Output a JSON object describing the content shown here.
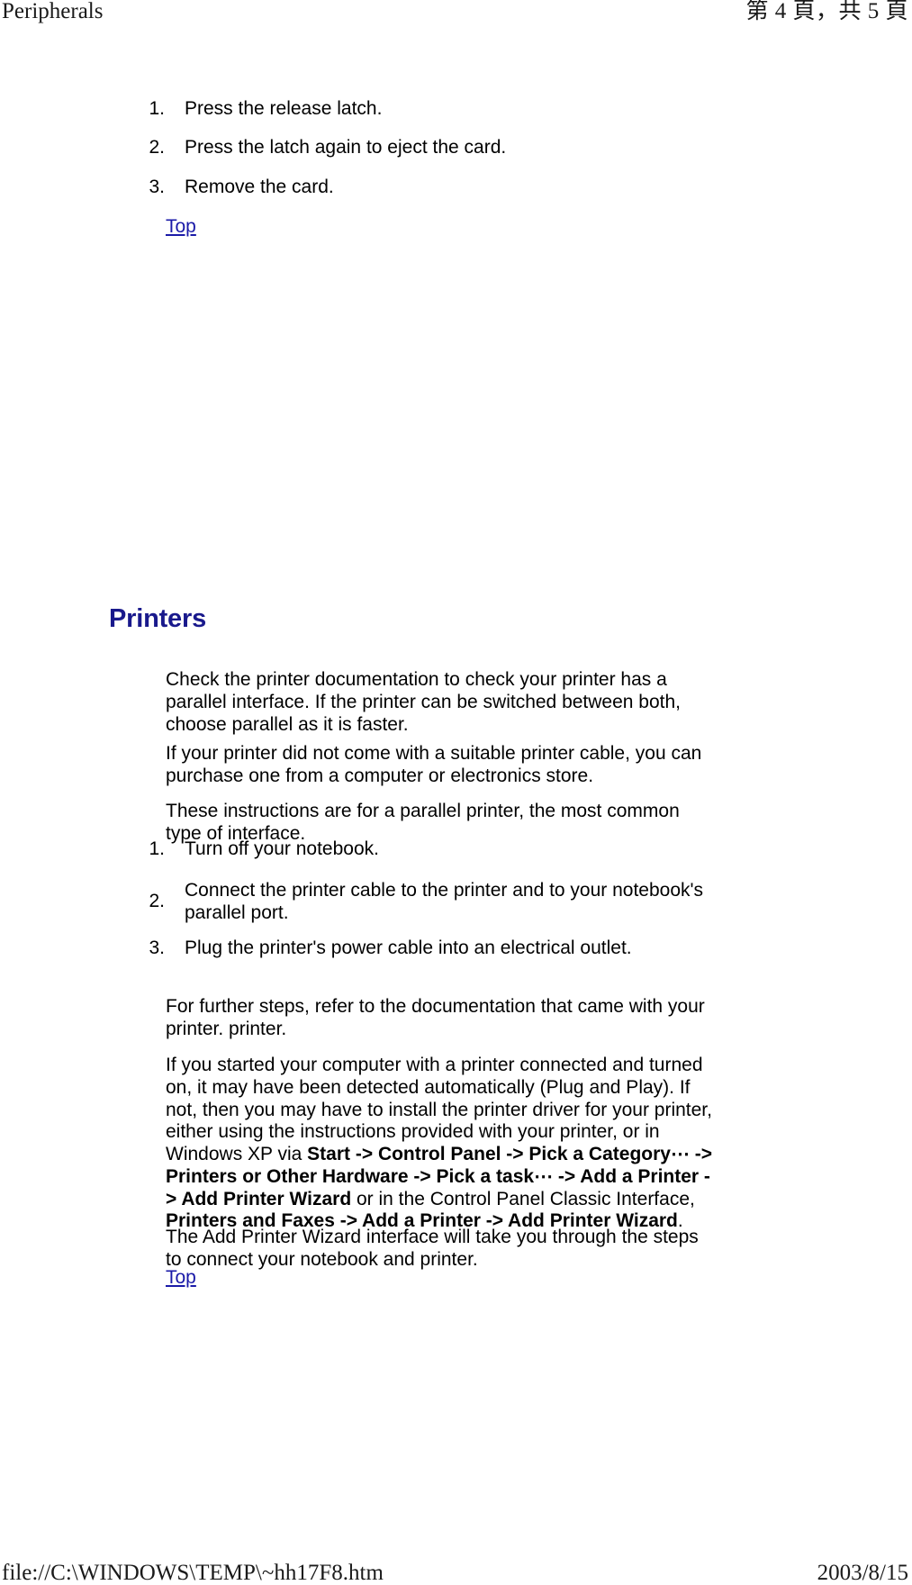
{
  "print_chrome": {
    "header_left": "Peripherals",
    "header_right": "第 4 頁，共 5 頁",
    "footer_left": "file://C:\\WINDOWS\\TEMP\\~hh17F8.htm",
    "footer_right": "2003/8/15"
  },
  "colors": {
    "heading": "#19198c",
    "link": "#1a1aa8",
    "text": "#000000",
    "background": "#ffffff"
  },
  "pcmcia_steps": [
    {
      "num": "1.",
      "text": "Press the release latch."
    },
    {
      "num": "2.",
      "text": "Press the latch again to eject the card."
    },
    {
      "num": "3.",
      "text": "Remove the card."
    }
  ],
  "top_link_1": "Top",
  "printers": {
    "heading": "Printers",
    "intro_paragraphs": [
      "Check the printer documentation to check your printer has a parallel interface. If the printer can be switched between both, choose parallel as it is faster.",
      "If your printer did not come with a suitable printer cable, you can purchase one from a computer or electronics store.",
      "These instructions are for a parallel printer, the most common type of interface."
    ],
    "steps": [
      {
        "num": "1.",
        "text": "Turn off your notebook."
      },
      {
        "num": "2.",
        "text": "Connect the printer cable to the printer and to your notebook's parallel port."
      },
      {
        "num": "3.",
        "text": "Plug the printer's power cable into an electrical outlet."
      }
    ],
    "further_paragraph": "For further steps, refer to the documentation that came with your printer. printer.",
    "driver_paragraph": {
      "part1": "If you started your computer with a printer connected and turned on, it may have been detected automatically (Plug and Play). If not, then you may have to install the printer driver for your printer, either using the instructions provided with your printer, or in Windows XP via ",
      "bold1": "Start -> Control Panel -> Pick a Category⋯ -> Printers or Other Hardware -> Pick a task⋯ -> Add a Printer -> Add Printer Wizard",
      "part2": " or in the Control Panel Classic Interface, ",
      "bold2": "Printers and Faxes -> Add a Printer -> Add Printer Wizard",
      "part3": "."
    },
    "wizard_paragraph": "The Add Printer Wizard interface will take you through the steps to connect your notebook and printer.",
    "top_link": "Top"
  }
}
